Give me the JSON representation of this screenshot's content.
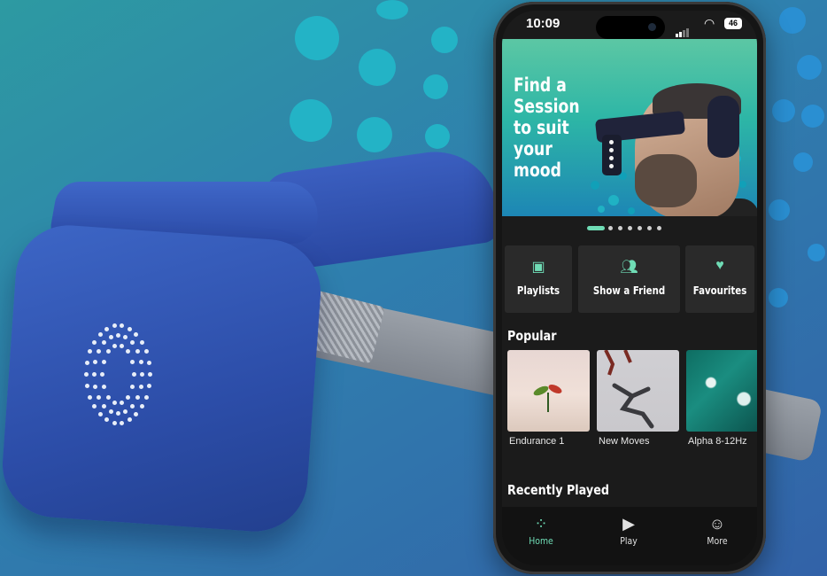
{
  "status_bar": {
    "time": "10:09",
    "battery": "46"
  },
  "banner": {
    "lines": [
      "Find a",
      "Session",
      "to suit",
      "your",
      "mood"
    ],
    "pager_count": 7,
    "pager_active": 0
  },
  "quick_actions": [
    {
      "label": "Playlists",
      "icon": "playlist-icon"
    },
    {
      "label": "Show a Friend",
      "icon": "users-icon"
    },
    {
      "label": "Favourites",
      "icon": "heart-icon"
    }
  ],
  "popular": {
    "title": "Popular",
    "items": [
      {
        "label": "Endurance 1",
        "image": "sprout"
      },
      {
        "label": "New Moves",
        "image": "runner"
      },
      {
        "label": "Alpha 8-12Hz",
        "image": "ocean-water"
      }
    ]
  },
  "recently_played": {
    "title": "Recently Played"
  },
  "tabs": [
    {
      "label": "Home",
      "icon": "home-dots-icon",
      "active": true
    },
    {
      "label": "Play",
      "icon": "play-circle-icon",
      "active": false
    },
    {
      "label": "More",
      "icon": "user-icon",
      "active": false
    }
  ],
  "colors": {
    "accent": "#6fdcb5",
    "background": "#1b1b1b",
    "card": "#2a2a2a"
  }
}
